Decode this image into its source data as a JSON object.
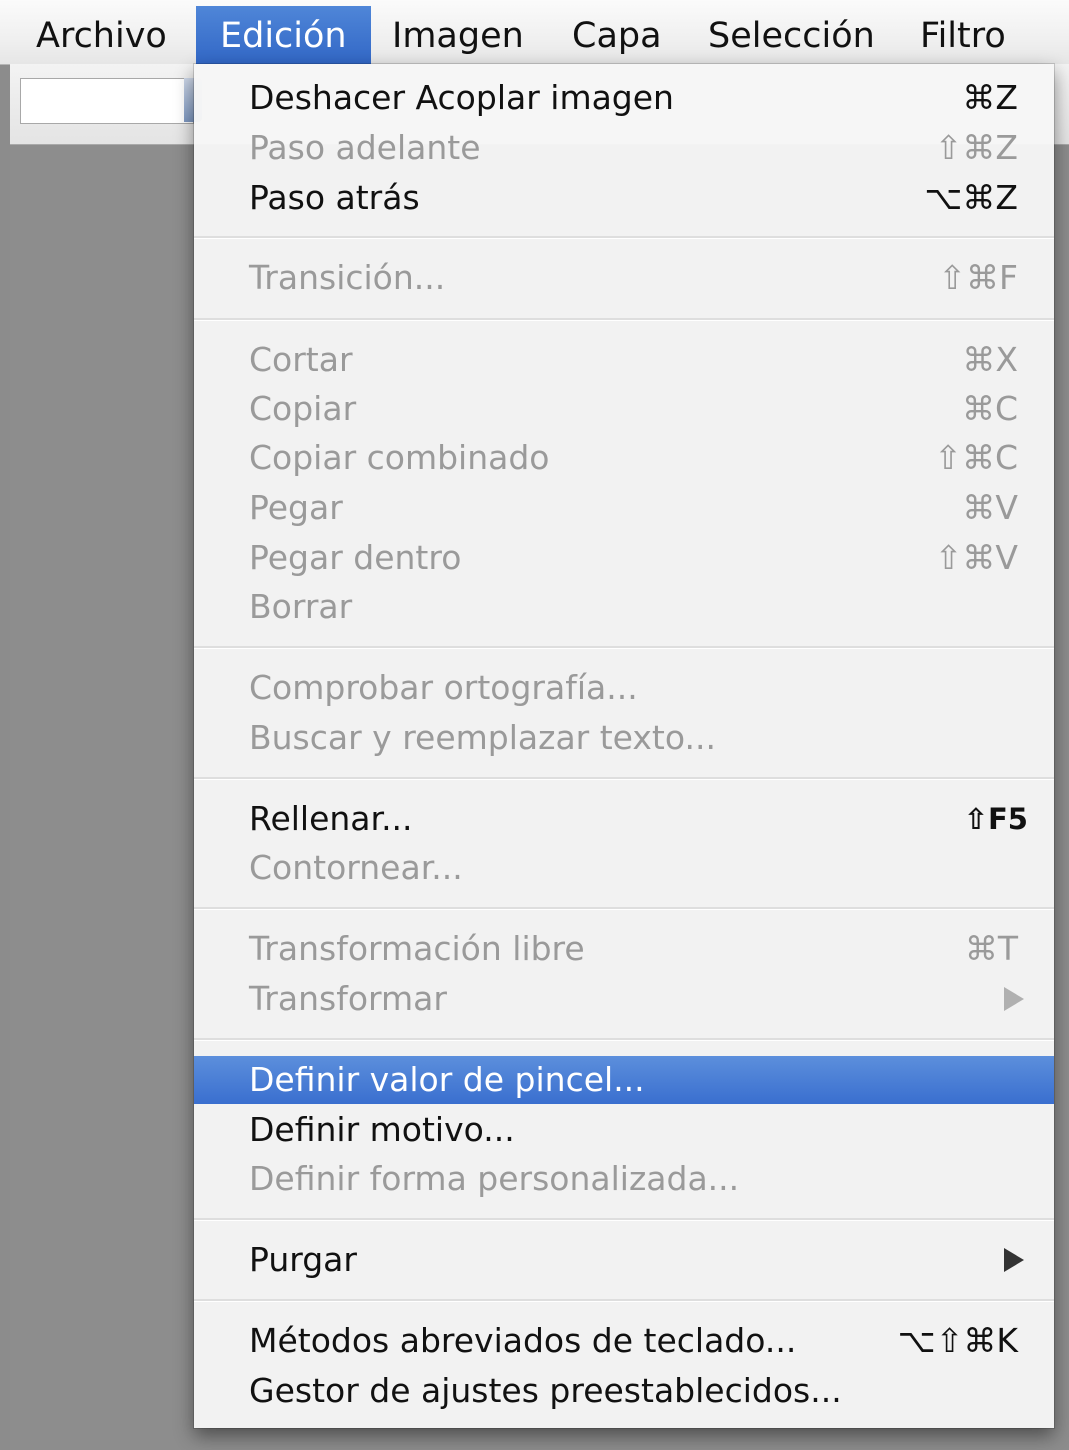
{
  "menubar": {
    "items": [
      {
        "label": "Archivo"
      },
      {
        "label": "Edición"
      },
      {
        "label": "Imagen"
      },
      {
        "label": "Capa"
      },
      {
        "label": "Selección"
      },
      {
        "label": "Filtro"
      }
    ]
  },
  "menu": {
    "title": "Edición",
    "items": [
      {
        "label": "Deshacer Acoplar imagen",
        "shortcut": "⌘Z",
        "enabled": true
      },
      {
        "label": "Paso adelante",
        "shortcut": "⇧⌘Z",
        "enabled": false
      },
      {
        "label": "Paso atrás",
        "shortcut": "⌥⌘Z",
        "enabled": true
      },
      {
        "label": "Transición...",
        "shortcut": "⇧⌘F",
        "enabled": false
      },
      {
        "label": "Cortar",
        "shortcut": "⌘X",
        "enabled": false
      },
      {
        "label": "Copiar",
        "shortcut": "⌘C",
        "enabled": false
      },
      {
        "label": "Copiar combinado",
        "shortcut": "⇧⌘C",
        "enabled": false
      },
      {
        "label": "Pegar",
        "shortcut": "⌘V",
        "enabled": false
      },
      {
        "label": "Pegar dentro",
        "shortcut": "⇧⌘V",
        "enabled": false
      },
      {
        "label": "Borrar",
        "shortcut": "",
        "enabled": false
      },
      {
        "label": "Comprobar ortografía...",
        "shortcut": "",
        "enabled": false
      },
      {
        "label": "Buscar y reemplazar texto...",
        "shortcut": "",
        "enabled": false
      },
      {
        "label": "Rellenar...",
        "shortcut": "⇧F5",
        "enabled": true
      },
      {
        "label": "Contornear...",
        "shortcut": "",
        "enabled": false
      },
      {
        "label": "Transformación libre",
        "shortcut": "⌘T",
        "enabled": false
      },
      {
        "label": "Transformar",
        "shortcut": "",
        "enabled": false,
        "submenu": true
      },
      {
        "label": "Definir valor de pincel...",
        "shortcut": "",
        "enabled": true,
        "highlighted": true
      },
      {
        "label": "Definir motivo...",
        "shortcut": "",
        "enabled": true
      },
      {
        "label": "Definir forma personalizada...",
        "shortcut": "",
        "enabled": false
      },
      {
        "label": "Purgar",
        "shortcut": "",
        "enabled": true,
        "submenu": true
      },
      {
        "label": "Métodos abreviados de teclado...",
        "shortcut": "⌥⇧⌘K",
        "enabled": true
      },
      {
        "label": "Gestor de ajustes preestablecidos...",
        "shortcut": "",
        "enabled": true
      }
    ]
  },
  "colors": {
    "highlight": "#3a6fcf",
    "disabled_text": "#9a9a9a",
    "background": "#8c8c8c"
  }
}
